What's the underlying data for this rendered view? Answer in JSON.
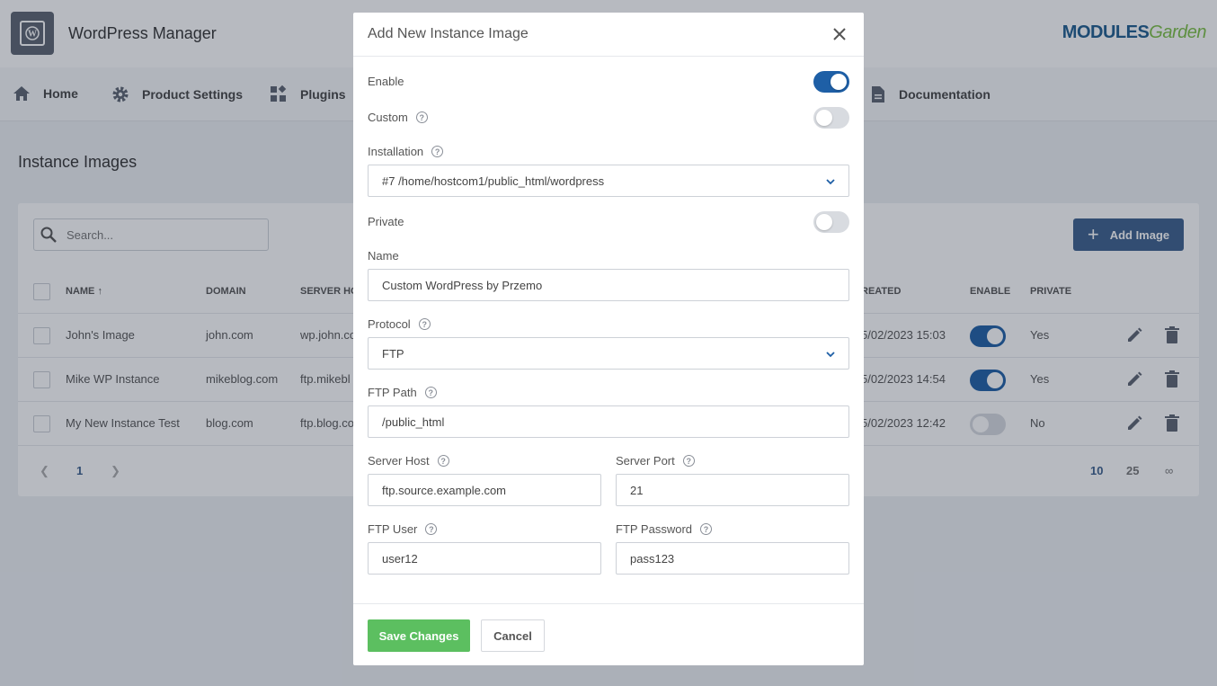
{
  "app": {
    "title": "WordPress Manager",
    "brand_part1": "MODULES",
    "brand_part2": "Garden"
  },
  "nav": {
    "home": "Home",
    "product_settings": "Product Settings",
    "plugins": "Plugins",
    "documentation": "Documentation"
  },
  "page": {
    "title": "Instance Images",
    "search_placeholder": "Search...",
    "add_button": "Add Image"
  },
  "table": {
    "headers": {
      "name": "NAME",
      "domain": "DOMAIN",
      "server_host": "SERVER HO",
      "created": "REATED",
      "enable": "ENABLE",
      "private": "PRIVATE"
    },
    "rows": [
      {
        "name": "John's Image",
        "domain": "john.com",
        "host": "wp.john.co",
        "created": "5/02/2023 15:03",
        "enabled": true,
        "private": "Yes"
      },
      {
        "name": "Mike WP Instance",
        "domain": "mikeblog.com",
        "host": "ftp.mikebl",
        "created": "5/02/2023 14:54",
        "enabled": true,
        "private": "Yes"
      },
      {
        "name": "My New Instance Test",
        "domain": "blog.com",
        "host": "ftp.blog.co",
        "created": "5/02/2023 12:42",
        "enabled": false,
        "private": "No"
      }
    ],
    "pagination": {
      "current_page": "1",
      "page_sizes": [
        "10",
        "25",
        "∞"
      ]
    }
  },
  "modal": {
    "title": "Add New Instance Image",
    "enable_label": "Enable",
    "enable_value": true,
    "custom_label": "Custom",
    "custom_value": false,
    "installation_label": "Installation",
    "installation_value": "#7 /home/hostcom1/public_html/wordpress",
    "private_label": "Private",
    "private_value": false,
    "name_label": "Name",
    "name_value": "Custom WordPress by Przemo",
    "protocol_label": "Protocol",
    "protocol_value": "FTP",
    "ftp_path_label": "FTP Path",
    "ftp_path_value": "/public_html",
    "server_host_label": "Server Host",
    "server_host_value": "ftp.source.example.com",
    "server_port_label": "Server Port",
    "server_port_value": "21",
    "ftp_user_label": "FTP User",
    "ftp_user_value": "user12",
    "ftp_password_label": "FTP Password",
    "ftp_password_value": "pass123",
    "save_button": "Save Changes",
    "cancel_button": "Cancel"
  },
  "colors": {
    "primary": "#1e5fa6",
    "add_button": "#3b5f8c",
    "save_button": "#5cbf60",
    "toggle_off": "#d8dbe0"
  }
}
